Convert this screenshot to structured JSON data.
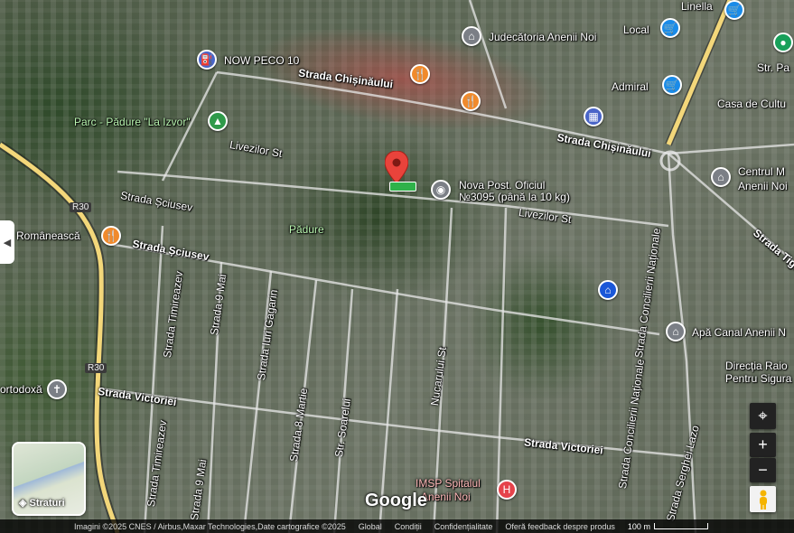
{
  "map": {
    "place_labels": [
      "NOW PECO 10",
      "Judecătoria Anenii Noi",
      "Local",
      "Linella",
      "Admiral",
      "Casa de Cultu",
      "Centrul M",
      "Anenii Noi",
      "Str. Pa",
      "Parc - Pădure \"La Izvor\"",
      "Pădure",
      "Nova Post. Oficiul",
      "№3095 (până la 10 kg)",
      "a Românească",
      "Apă Canal Anenii N",
      "Direcția Raio",
      "Pentru Sigura",
      "ortodoxă",
      "IMSP Spitalul",
      "Anenii Noi"
    ],
    "street_labels": [
      "Strada Chișinăului",
      "Strada Chișinăului",
      "Livezilor St",
      "Livezilor St",
      "Strada Șciusev",
      "Strada Șciusev",
      "Strada Timireazev",
      "Strada 9 Mai",
      "Strada Iuri Gagarin",
      "Strada 8 Martie",
      "Str. Soarelui",
      "Nucarului St",
      "Strada Victoriei",
      "Strada Victoriei",
      "Strada Concilierii Naționale",
      "Strada Concilierii Naționale",
      "Strada Serghei Lazo",
      "Strada Timireazev",
      "Strada 9 Mai",
      "Strada Tiga"
    ],
    "road_shields": [
      "R30",
      "R30"
    ]
  },
  "layers_button": {
    "label": "Straturi"
  },
  "controls": {
    "zoom_in": "+",
    "zoom_out": "−"
  },
  "branding": {
    "logo": "Google"
  },
  "attribution": {
    "imagery": "Imagini ©2025 CNES / Airbus,Maxar Technologies,Date cartografice ©2025",
    "global": "Global",
    "terms": "Condiții",
    "privacy": "Confidențialitate",
    "feedback": "Oferă feedback despre produs",
    "scale": "100 m"
  }
}
